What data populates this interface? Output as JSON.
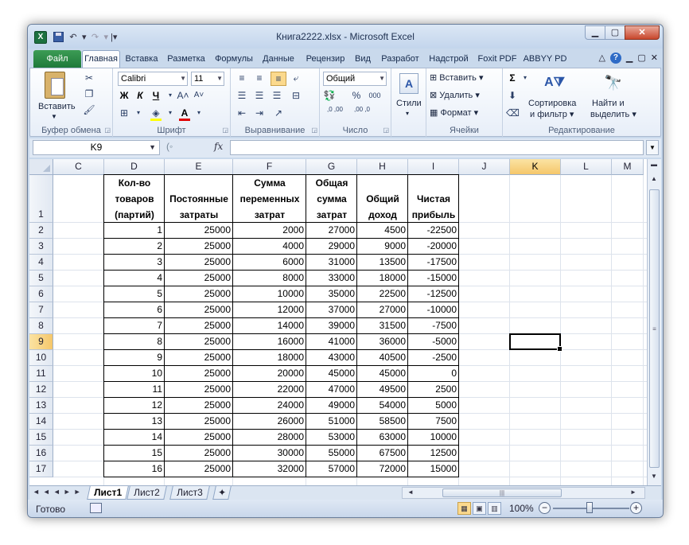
{
  "window": {
    "title": "Книга2222.xlsx - Microsoft Excel",
    "app_icon": "X"
  },
  "qat": {
    "undo_arrow": "▾",
    "redo_arrow": "▾",
    "customize": "|▾"
  },
  "tabs": {
    "file": "Файл",
    "items": [
      "Главная",
      "Вставка",
      "Разметка",
      "Формулы",
      "Данные",
      "Рецензир",
      "Вид",
      "Разработ",
      "Надстрой",
      "Foxit PDF",
      "ABBYY PD"
    ],
    "active": "Главная"
  },
  "ribbon": {
    "clipboard": {
      "label": "Буфер обмена",
      "paste": "Вставить"
    },
    "font": {
      "label": "Шрифт",
      "name": "Calibri",
      "size": "11",
      "bold": "Ж",
      "italic": "К",
      "underline": "Ч",
      "grow": "A˄",
      "shrink": "A˅",
      "fill_color": "#ffff00",
      "font_color": "#e00000"
    },
    "alignment": {
      "label": "Выравнивание"
    },
    "number": {
      "label": "Число",
      "format": "Общий",
      "percent": "%",
      "thousands": "000",
      "inc_dec": ",0 ,00",
      "dec_dec": ",00 ,0"
    },
    "styles": {
      "label": "Стили",
      "btn": "Стили"
    },
    "cells": {
      "label": "Ячейки",
      "insert": "Вставить",
      "delete": "Удалить",
      "format": "Формат"
    },
    "editing": {
      "label": "Редактирование",
      "sum": "Σ",
      "sort1": "Сортировка",
      "sort2": "и фильтр",
      "find1": "Найти и",
      "find2": "выделить"
    }
  },
  "formula_bar": {
    "name_box": "K9",
    "fx": "fx",
    "value": ""
  },
  "columns": [
    "C",
    "D",
    "E",
    "F",
    "G",
    "H",
    "I",
    "J",
    "K",
    "L",
    "M"
  ],
  "selected_column": "K",
  "selected_row": 9,
  "header": {
    "d": [
      "Кол-во",
      "товаров",
      "(партий)"
    ],
    "e": [
      "Постоянные",
      "затраты"
    ],
    "f": [
      "Сумма",
      "переменных",
      "затрат"
    ],
    "g": [
      "Общая",
      "сумма",
      "затрат"
    ],
    "h": [
      "Общий",
      "доход"
    ],
    "i": [
      "Чистая",
      "прибыль"
    ]
  },
  "rows": [
    {
      "n": "2",
      "d": "1",
      "e": "25000",
      "f": "2000",
      "g": "27000",
      "h": "4500",
      "i": "-22500"
    },
    {
      "n": "3",
      "d": "2",
      "e": "25000",
      "f": "4000",
      "g": "29000",
      "h": "9000",
      "i": "-20000"
    },
    {
      "n": "4",
      "d": "3",
      "e": "25000",
      "f": "6000",
      "g": "31000",
      "h": "13500",
      "i": "-17500"
    },
    {
      "n": "5",
      "d": "4",
      "e": "25000",
      "f": "8000",
      "g": "33000",
      "h": "18000",
      "i": "-15000"
    },
    {
      "n": "6",
      "d": "5",
      "e": "25000",
      "f": "10000",
      "g": "35000",
      "h": "22500",
      "i": "-12500"
    },
    {
      "n": "7",
      "d": "6",
      "e": "25000",
      "f": "12000",
      "g": "37000",
      "h": "27000",
      "i": "-10000"
    },
    {
      "n": "8",
      "d": "7",
      "e": "25000",
      "f": "14000",
      "g": "39000",
      "h": "31500",
      "i": "-7500"
    },
    {
      "n": "9",
      "d": "8",
      "e": "25000",
      "f": "16000",
      "g": "41000",
      "h": "36000",
      "i": "-5000"
    },
    {
      "n": "10",
      "d": "9",
      "e": "25000",
      "f": "18000",
      "g": "43000",
      "h": "40500",
      "i": "-2500"
    },
    {
      "n": "11",
      "d": "10",
      "e": "25000",
      "f": "20000",
      "g": "45000",
      "h": "45000",
      "i": "0"
    },
    {
      "n": "12",
      "d": "11",
      "e": "25000",
      "f": "22000",
      "g": "47000",
      "h": "49500",
      "i": "2500"
    },
    {
      "n": "13",
      "d": "12",
      "e": "25000",
      "f": "24000",
      "g": "49000",
      "h": "54000",
      "i": "5000"
    },
    {
      "n": "14",
      "d": "13",
      "e": "25000",
      "f": "26000",
      "g": "51000",
      "h": "58500",
      "i": "7500"
    },
    {
      "n": "15",
      "d": "14",
      "e": "25000",
      "f": "28000",
      "g": "53000",
      "h": "63000",
      "i": "10000"
    },
    {
      "n": "16",
      "d": "15",
      "e": "25000",
      "f": "30000",
      "g": "55000",
      "h": "67500",
      "i": "12500"
    },
    {
      "n": "17",
      "d": "16",
      "e": "25000",
      "f": "32000",
      "g": "57000",
      "h": "72000",
      "i": "15000"
    }
  ],
  "first_row_number": "1",
  "sheets": {
    "tabs": [
      "Лист1",
      "Лист2",
      "Лист3"
    ],
    "active": "Лист1",
    "nav": "◄◄◄►►"
  },
  "status": {
    "ready": "Готово",
    "zoom": "100%",
    "minus": "−",
    "plus": "+"
  }
}
